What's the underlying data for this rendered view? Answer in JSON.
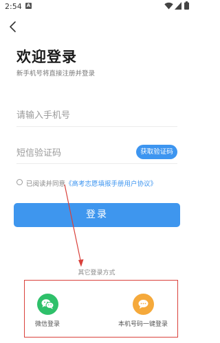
{
  "status_bar": {
    "time": "2:54",
    "notification_letter": "A",
    "icons": [
      "wifi-icon",
      "signal-icon",
      "battery-icon"
    ]
  },
  "header": {
    "back_icon": "chevron-left-icon"
  },
  "login": {
    "title": "欢迎登录",
    "subtitle": "新手机号将直接注册并登录",
    "phone_placeholder": "请输入手机号",
    "code_placeholder": "短信验证码",
    "get_code_label": "获取验证码",
    "agree_prefix": "已阅读并同意",
    "agree_link": "《高考志愿填报手册用户协议》",
    "login_button": "登录"
  },
  "other_login": {
    "label": "其它登录方式",
    "options": [
      {
        "label": "微信登录",
        "icon": "wechat-icon"
      },
      {
        "label": "本机号码一键登录",
        "icon": "chat-bubble-icon"
      }
    ]
  },
  "annotation": {
    "color": "#d9403a"
  },
  "colors": {
    "accent": "#3e96ee",
    "wechat": "#2ec06a",
    "onekey": "#f5a93b"
  }
}
